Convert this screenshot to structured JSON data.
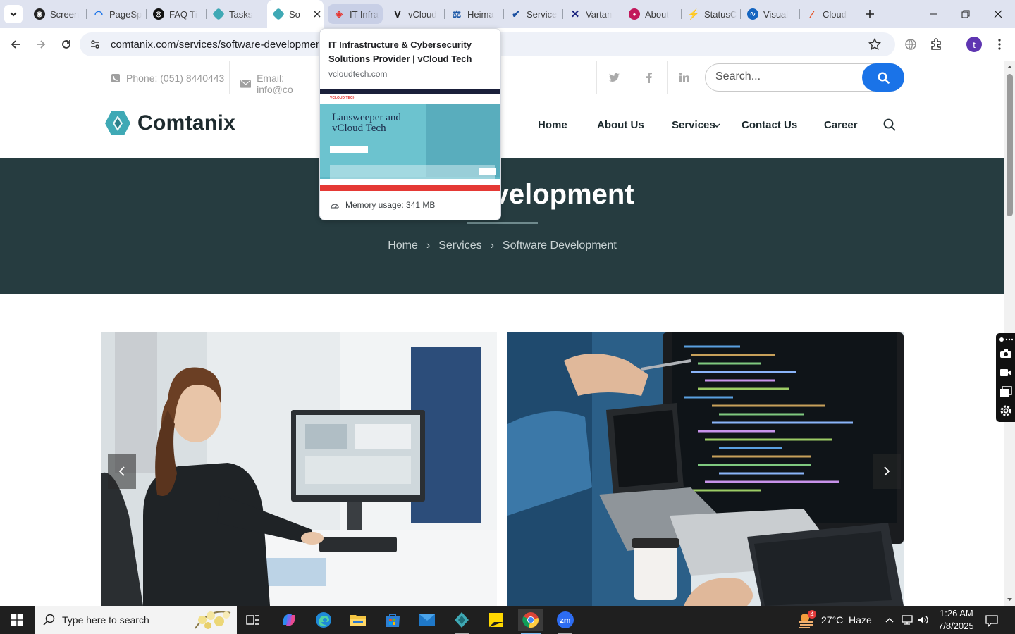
{
  "browser": {
    "tabs": [
      {
        "label": "Screen",
        "icon": "screenpal-icon"
      },
      {
        "label": "PageSp",
        "icon": "pagespeed-icon"
      },
      {
        "label": "FAQ Ti",
        "icon": "faq-icon"
      },
      {
        "label": "Tasks",
        "icon": "tasks-icon"
      },
      {
        "label": "So",
        "icon": "comtanix-icon"
      },
      {
        "label": "IT Infra",
        "icon": "vcloud-icon"
      },
      {
        "label": "vCloud",
        "icon": "v-icon"
      },
      {
        "label": "Heima",
        "icon": "heimat-icon"
      },
      {
        "label": "Service",
        "icon": "service-icon"
      },
      {
        "label": "Vartan",
        "icon": "vartana-icon"
      },
      {
        "label": "About",
        "icon": "about-icon"
      },
      {
        "label": "StatusC",
        "icon": "status-icon"
      },
      {
        "label": "Visual",
        "icon": "visual-icon"
      },
      {
        "label": "Cloud",
        "icon": "cloud-icon"
      }
    ],
    "url": "comtanix.com/services/software-development/",
    "profile_initial": "t",
    "hover_card": {
      "title": "IT Infrastructure & Cybersecurity Solutions Provider | vCloud Tech",
      "domain": "vcloudtech.com",
      "memory": "Memory usage: 341 MB",
      "thumb_heading": "Lansweeper and vCloud Tech",
      "thumb_logo": "VCLOUD TECH"
    }
  },
  "site": {
    "phone": "Phone: (051) 8440443",
    "email": "Email: info@co",
    "search_placeholder": "Search...",
    "logo_text": "Comtanix",
    "nav": [
      "Home",
      "About Us",
      "Services",
      "Contact Us",
      "Career"
    ],
    "hero_title": "evelopment",
    "breadcrumb": [
      "Home",
      "Services",
      "Software Development"
    ]
  },
  "taskbar": {
    "search_placeholder": "Type here to search",
    "weather": "27°C  Haze",
    "weather_badge": "4",
    "time": "1:26 AM",
    "date": "7/8/2025"
  },
  "colors": {
    "hero_bg": "#263c40",
    "search_btn": "#1a73e8",
    "logo_teal": "#3fa9b5"
  }
}
